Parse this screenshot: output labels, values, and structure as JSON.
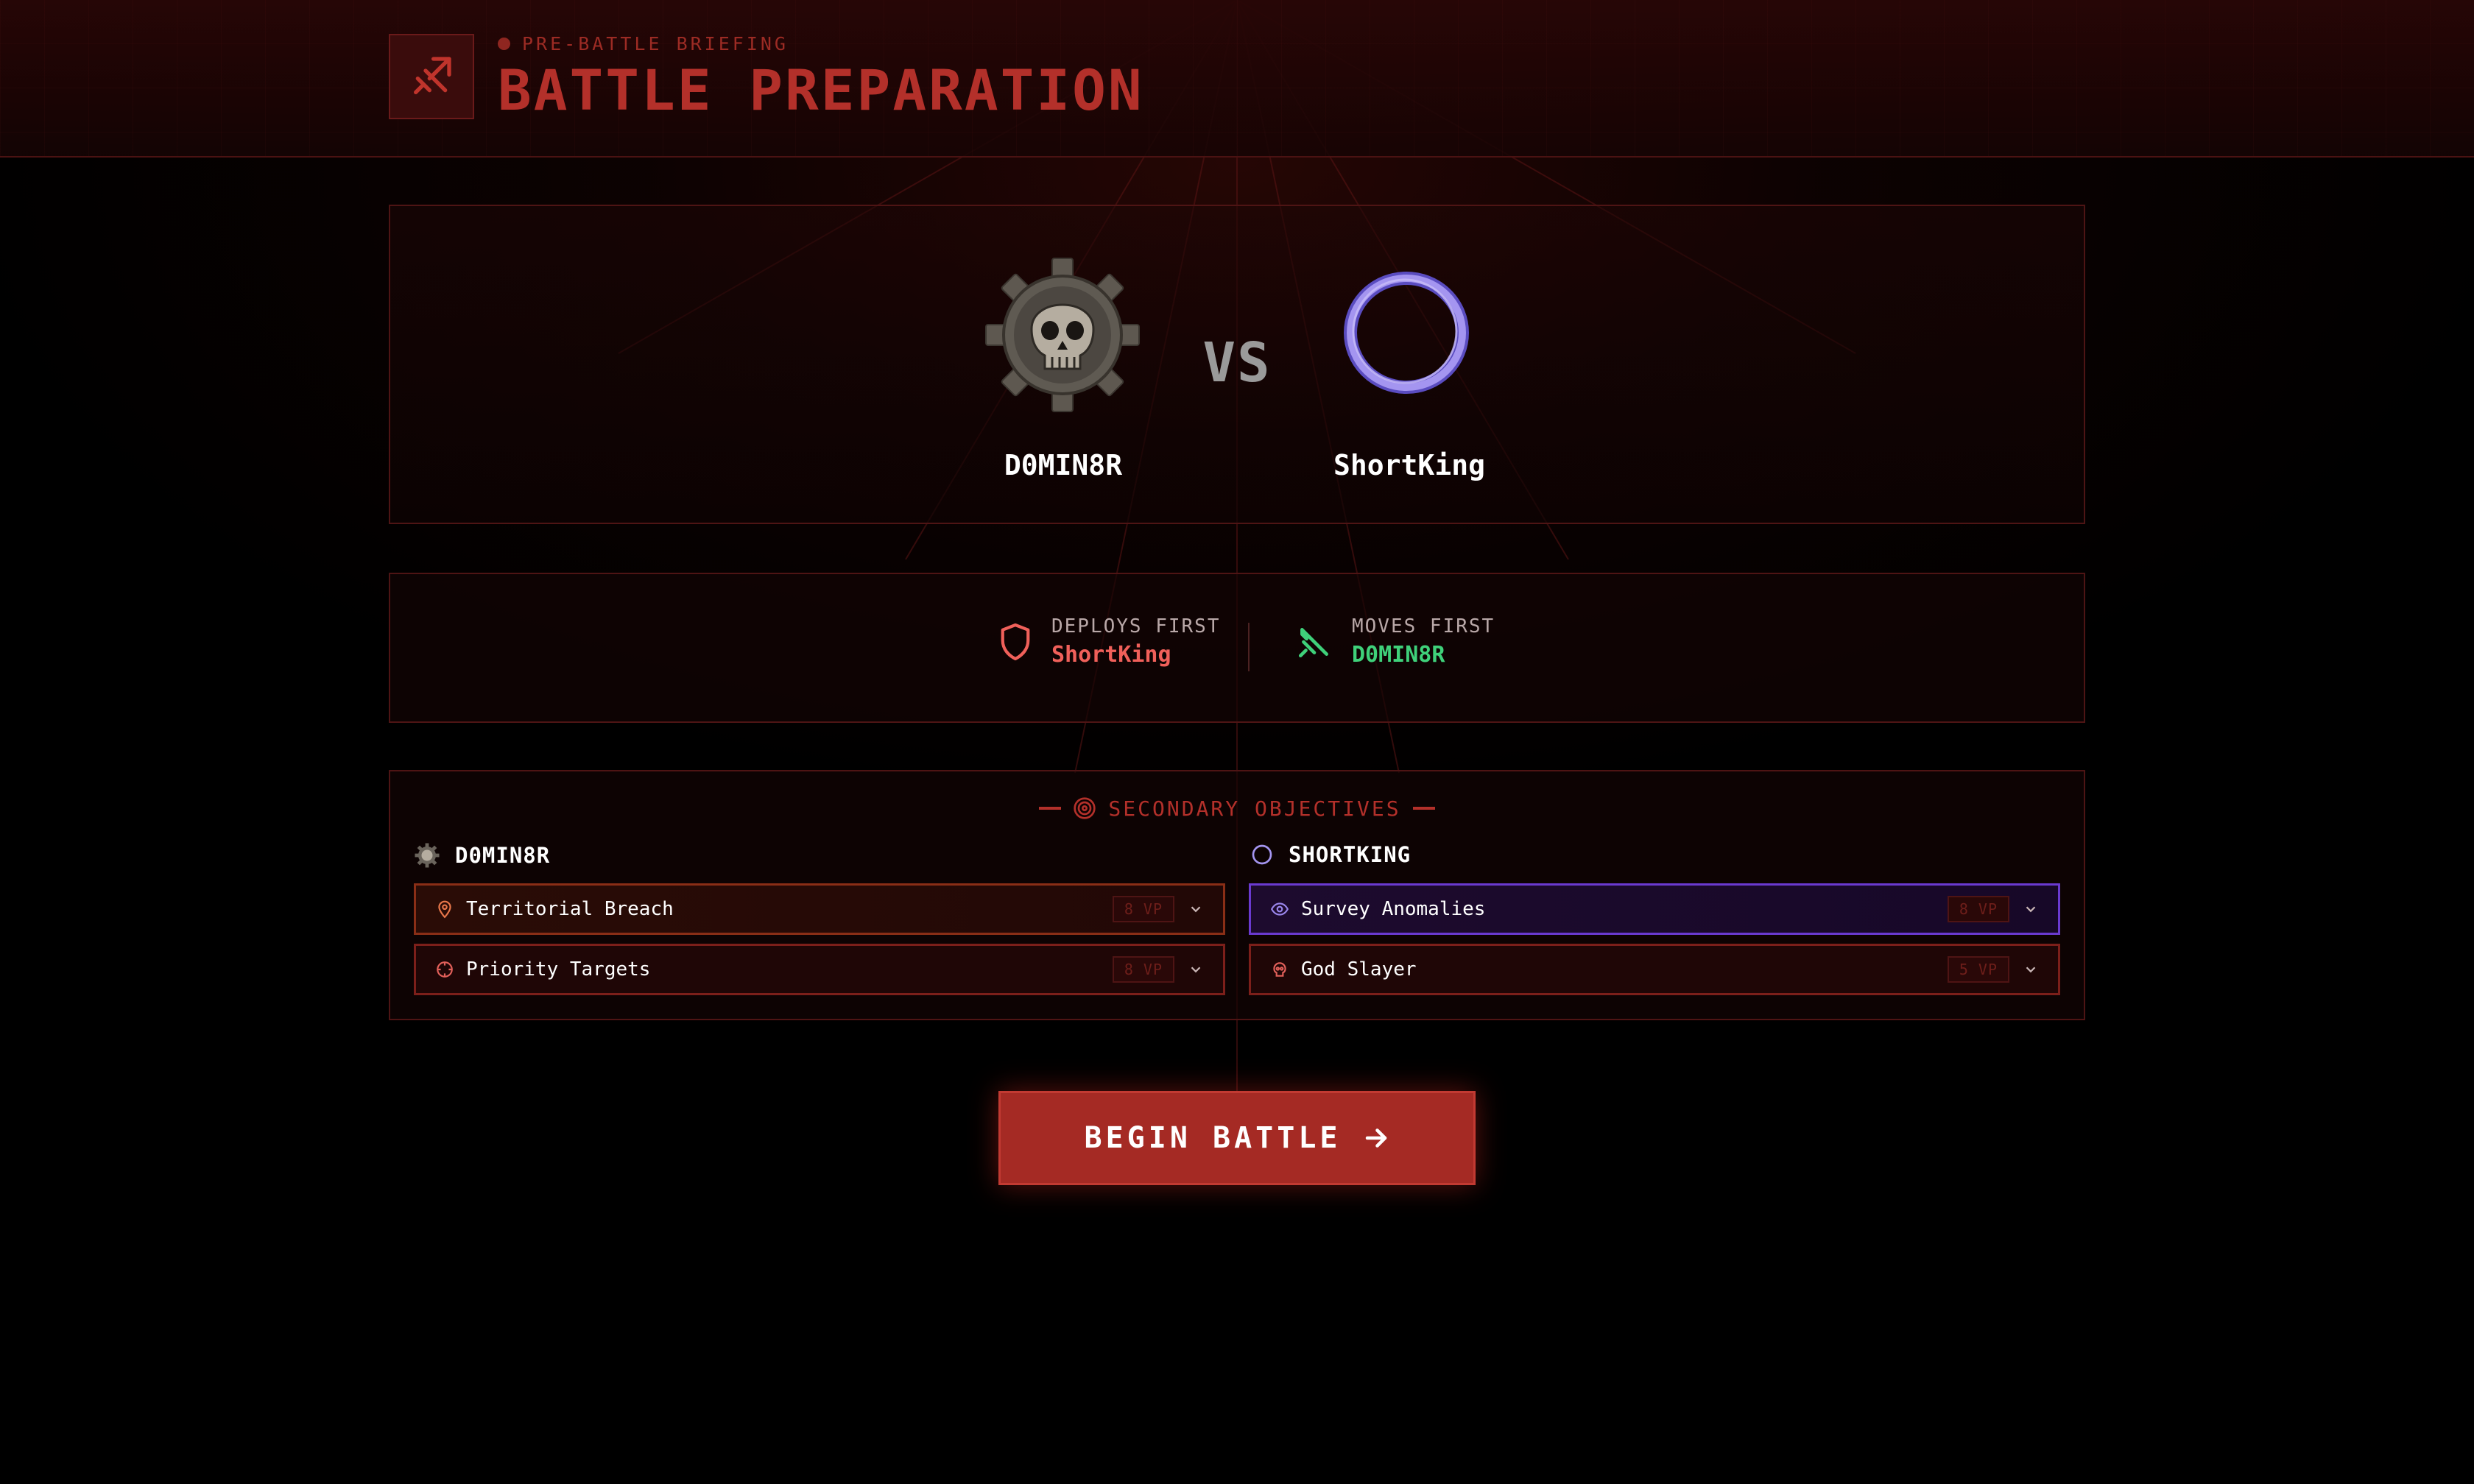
{
  "header": {
    "kicker": "PRE-BATTLE BRIEFING",
    "title": "BATTLE PREPARATION",
    "icon": "sword-icon"
  },
  "matchup": {
    "player1": {
      "name": "D0MIN8R",
      "emblem": "skull-cog-emblem"
    },
    "vs": "VS",
    "player2": {
      "name": "ShortKing",
      "emblem": "purple-ring-emblem"
    }
  },
  "order": {
    "deploys": {
      "label": "DEPLOYS FIRST",
      "player": "ShortKing",
      "icon": "shield-icon",
      "color": "#f0605a"
    },
    "moves": {
      "label": "MOVES FIRST",
      "player": "D0MIN8R",
      "icon": "sword-icon",
      "color": "#3fd17a"
    }
  },
  "objectives": {
    "heading": "SECONDARY OBJECTIVES",
    "left": {
      "player": "D0MIN8R",
      "items": [
        {
          "label": "Territorial Breach",
          "vp": "8 VP",
          "icon": "map-pin-icon"
        },
        {
          "label": "Priority Targets",
          "vp": "8 VP",
          "icon": "crosshair-icon"
        }
      ]
    },
    "right": {
      "player": "SHORTKING",
      "items": [
        {
          "label": "Survey Anomalies",
          "vp": "8 VP",
          "icon": "eye-icon"
        },
        {
          "label": "God Slayer",
          "vp": "5 VP",
          "icon": "skull-icon"
        }
      ]
    }
  },
  "actions": {
    "begin": "BEGIN BATTLE"
  },
  "colors": {
    "accent": "#b3302a",
    "button": "#a52a24",
    "deploy": "#f0605a",
    "moves": "#3fd17a",
    "purple": "#6a3ad0"
  }
}
